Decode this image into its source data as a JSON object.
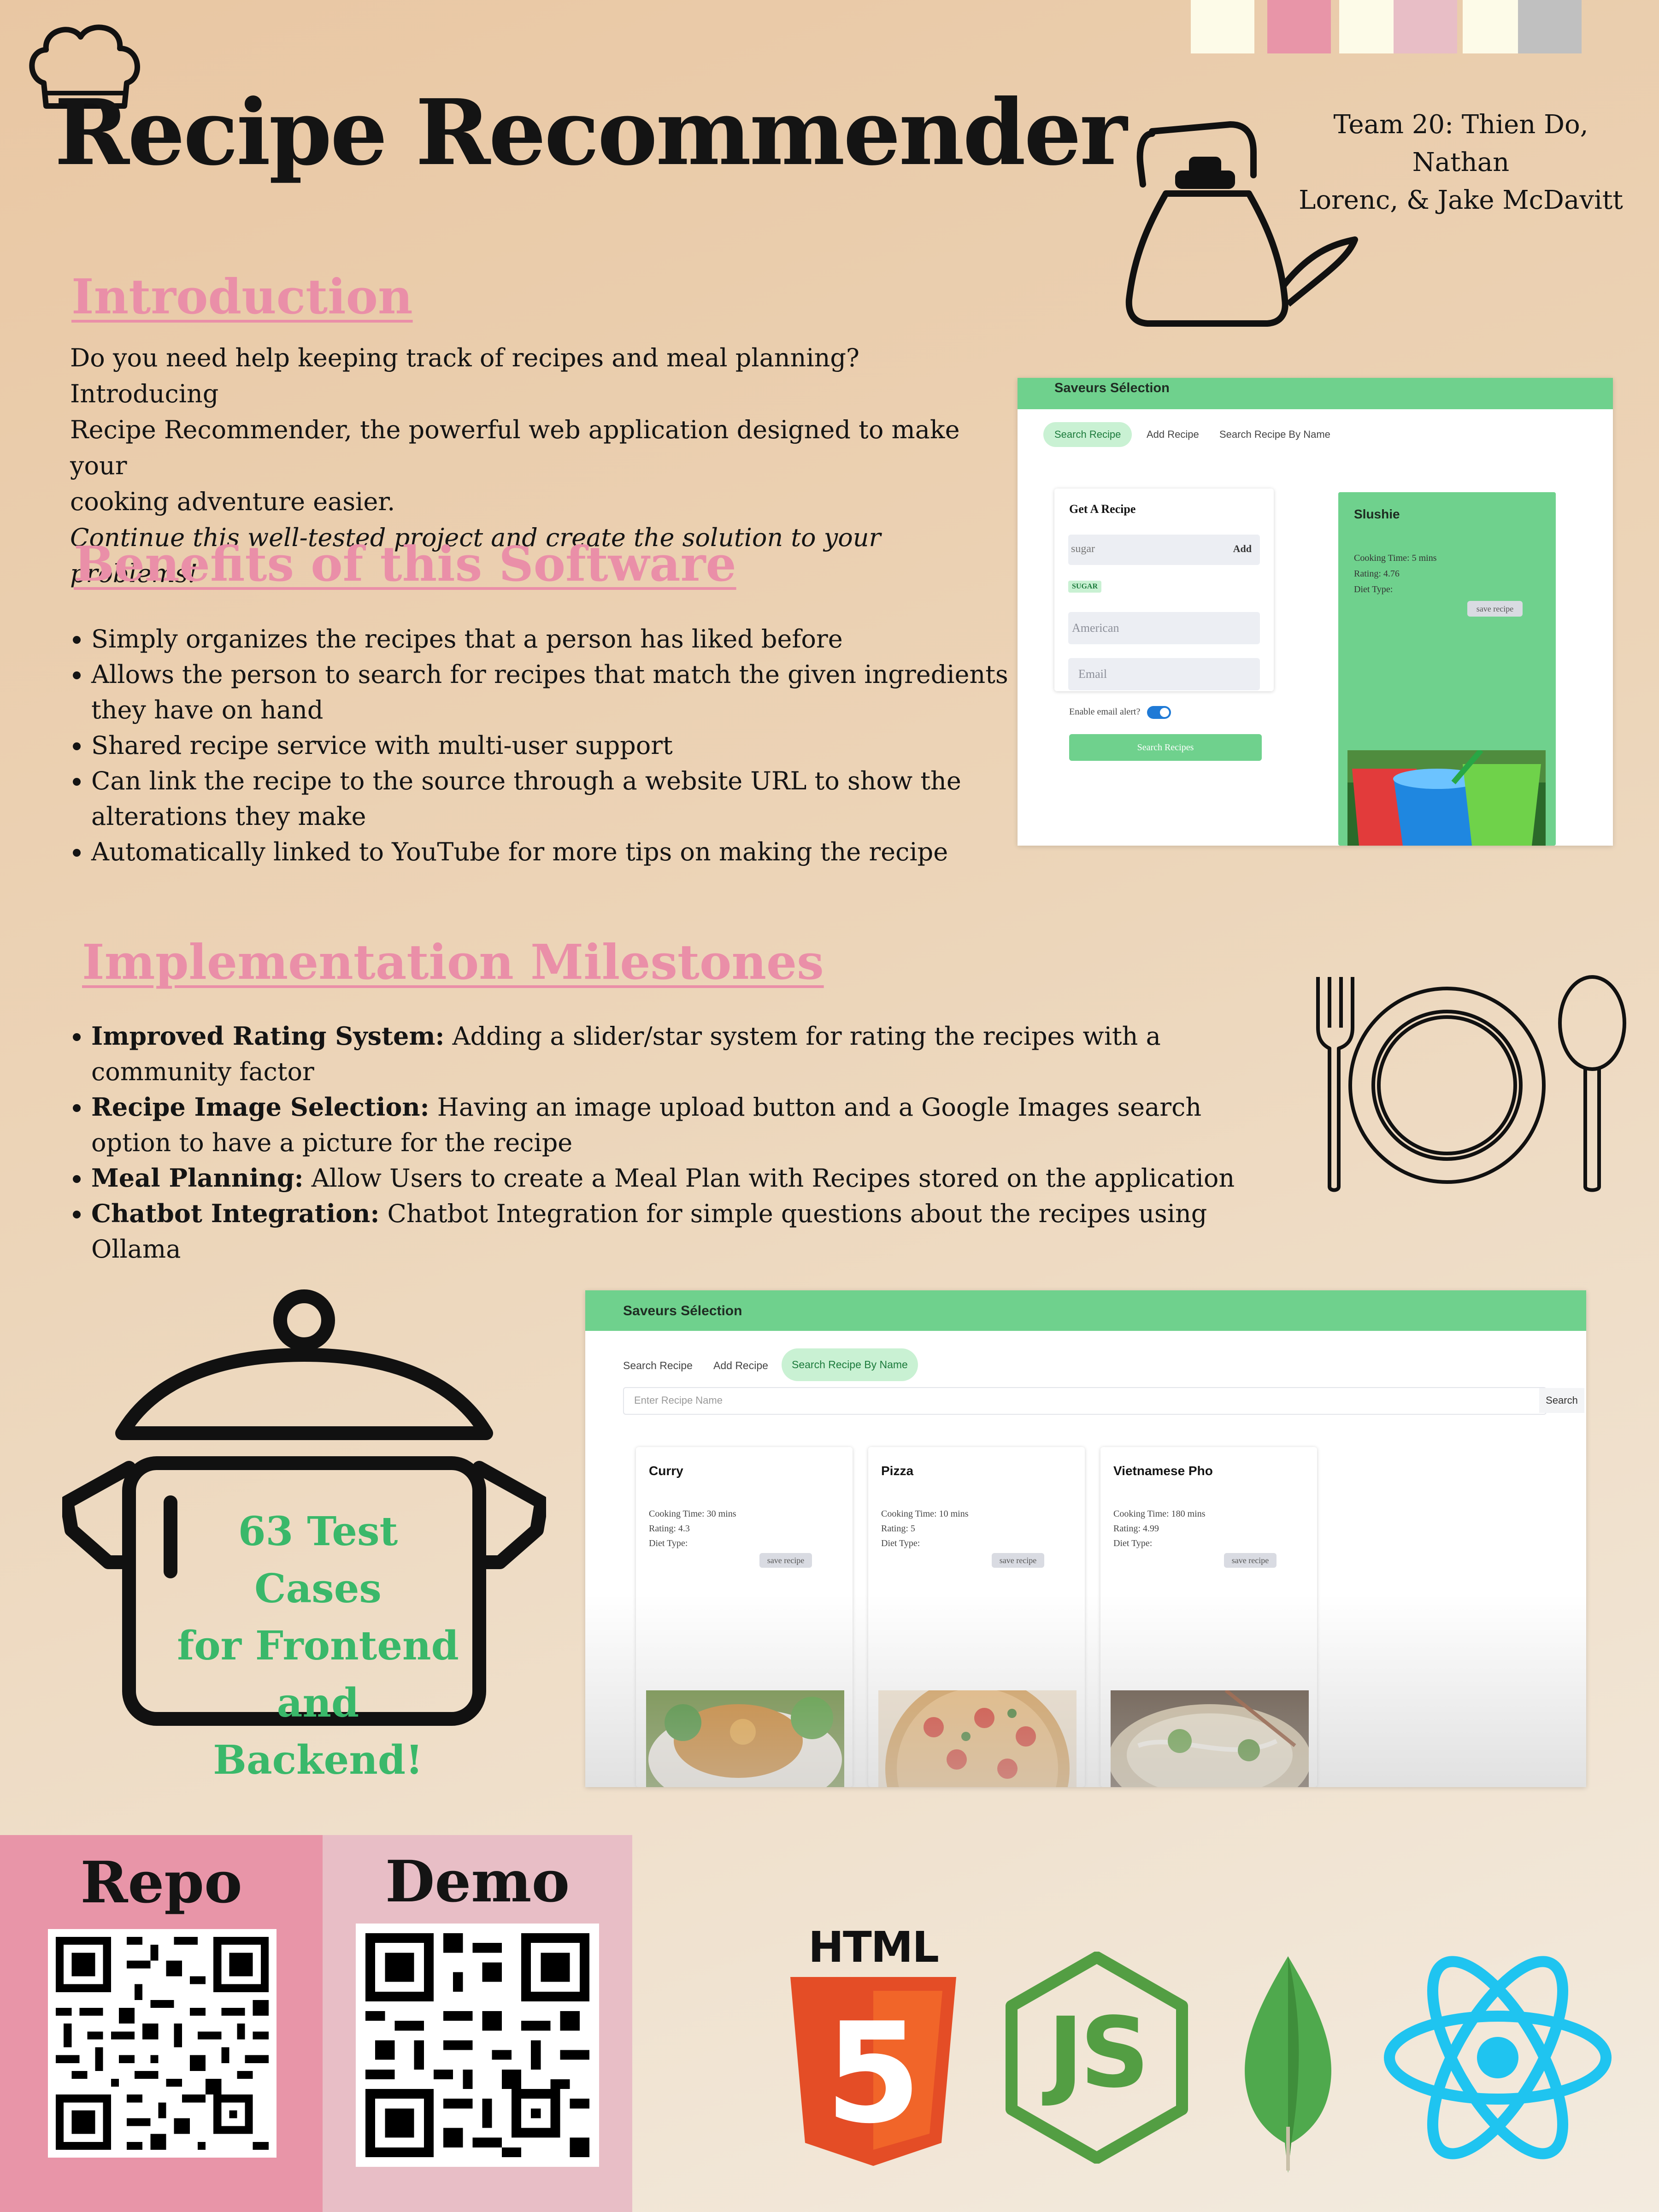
{
  "header": {
    "title": "Recipe Recommender",
    "team_line1": "Team 20: Thien Do, Nathan",
    "team_line2": "Lorenc, & Jake McDavitt"
  },
  "palette": [
    "#fdfbe8",
    "#e895a8",
    "#fdfbe8",
    "#e8bec6",
    "#fdfbe8",
    "#c0c0c0"
  ],
  "colors": {
    "heading_pink": "#ea8fa8",
    "app_green": "#6fd18d",
    "test_green": "#3ab86a",
    "repo_bg": "#e895a8",
    "demo_bg": "#e8bec6"
  },
  "introduction": {
    "heading": "Introduction",
    "line1": "Do you need help keeping track of recipes and meal planning? Introducing",
    "line2": "Recipe Recommender, the powerful web application designed to make your",
    "line3": "cooking adventure easier.",
    "tagline": "Continue this well-tested project and create the solution to your problems!"
  },
  "benefits": {
    "heading": "Benefits of this Software",
    "items": [
      "Simply organizes the recipes that a person has liked before",
      "Allows the person to search for recipes that match the given ingredients they have on hand",
      "Shared recipe service with multi-user support",
      "Can link the recipe to the source through a website URL to show the alterations they make",
      "Automatically linked to YouTube for more tips on making the recipe"
    ]
  },
  "milestones": {
    "heading": "Implementation Milestones",
    "items": [
      {
        "label": "Improved Rating System:",
        "text": " Adding a slider/star system for rating the recipes with a community factor"
      },
      {
        "label": "Recipe Image Selection:",
        "text": " Having an image upload button and a Google Images search option to have a picture for the recipe"
      },
      {
        "label": "Meal Planning:",
        "text": " Allow Users to create a Meal Plan with Recipes stored on the application"
      },
      {
        "label": "Chatbot Integration:",
        "text": " Chatbot Integration for simple questions about the recipes using Ollama"
      }
    ]
  },
  "screenshot1": {
    "app_name": "Saveurs Sélection",
    "tabs": [
      "Search Recipe",
      "Add Recipe",
      "Search Recipe By Name"
    ],
    "active_tab": 0,
    "form_title": "Get A Recipe",
    "ingredient_value": "sugar",
    "add_label": "Add",
    "chip": "SUGAR",
    "cuisine_value": "American",
    "email_placeholder": "Email",
    "alert_label": "Enable email alert?",
    "alert_enabled": true,
    "search_button": "Search Recipes",
    "result": {
      "name": "Slushie",
      "cooking_time": "Cooking Time: 5 mins",
      "rating": "Rating: 4.76",
      "diet": "Diet Type:",
      "save": "save recipe"
    }
  },
  "screenshot2": {
    "app_name": "Saveurs Sélection",
    "tabs": [
      "Search Recipe",
      "Add Recipe",
      "Search Recipe By Name"
    ],
    "active_tab": 2,
    "search_placeholder": "Enter Recipe Name",
    "search_button": "Search",
    "cards": [
      {
        "name": "Curry",
        "cooking_time": "Cooking Time: 30 mins",
        "rating": "Rating: 4.3",
        "diet": "Diet Type:",
        "save": "save recipe"
      },
      {
        "name": "Pizza",
        "cooking_time": "Cooking Time: 10 mins",
        "rating": "Rating: 5",
        "diet": "Diet Type:",
        "save": "save recipe"
      },
      {
        "name": "Vietnamese Pho",
        "cooking_time": "Cooking Time: 180 mins",
        "rating": "Rating: 4.99",
        "diet": "Diet Type:",
        "save": "save recipe"
      }
    ]
  },
  "tests": {
    "line1": "63 Test Cases",
    "line2": "for Frontend",
    "line3": "and Backend!"
  },
  "links": {
    "repo_label": "Repo",
    "demo_label": "Demo"
  },
  "tech": {
    "html_label": "HTML",
    "html_number": "5",
    "node_label": "JS"
  },
  "icons": [
    "chef-hat-icon",
    "kettle-icon",
    "plate-cutlery-icon",
    "cooking-pot-icon",
    "html5-logo-icon",
    "nodejs-logo-icon",
    "mongodb-leaf-icon",
    "react-logo-icon",
    "qr-code-icon"
  ]
}
